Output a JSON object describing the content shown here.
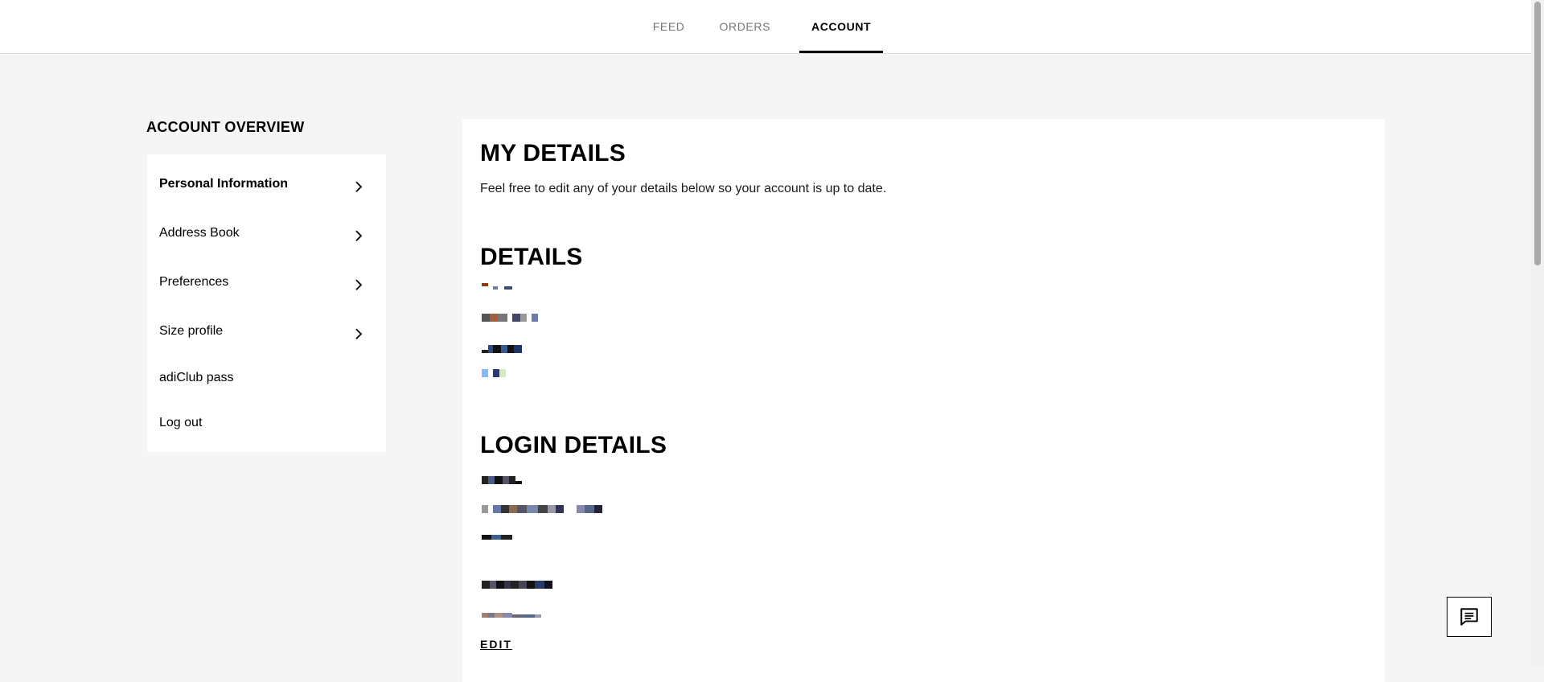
{
  "nav": {
    "tabs": [
      {
        "label": "FEED"
      },
      {
        "label": "ORDERS"
      },
      {
        "label": "ACCOUNT"
      }
    ]
  },
  "sidebar": {
    "title": "ACCOUNT OVERVIEW",
    "items": [
      {
        "label": "Personal Information"
      },
      {
        "label": "Address Book"
      },
      {
        "label": "Preferences"
      },
      {
        "label": "Size profile"
      },
      {
        "label": "adiClub pass"
      },
      {
        "label": "Log out"
      }
    ]
  },
  "main": {
    "title": "MY DETAILS",
    "intro": "Feel free to edit any of your details below so your account is up to date.",
    "details_heading": "DETAILS",
    "login_heading": "LOGIN DETAILS",
    "edit_label": "EDIT"
  },
  "icons": {
    "chevron": "chevron-right-icon",
    "chat": "chat-icon"
  }
}
